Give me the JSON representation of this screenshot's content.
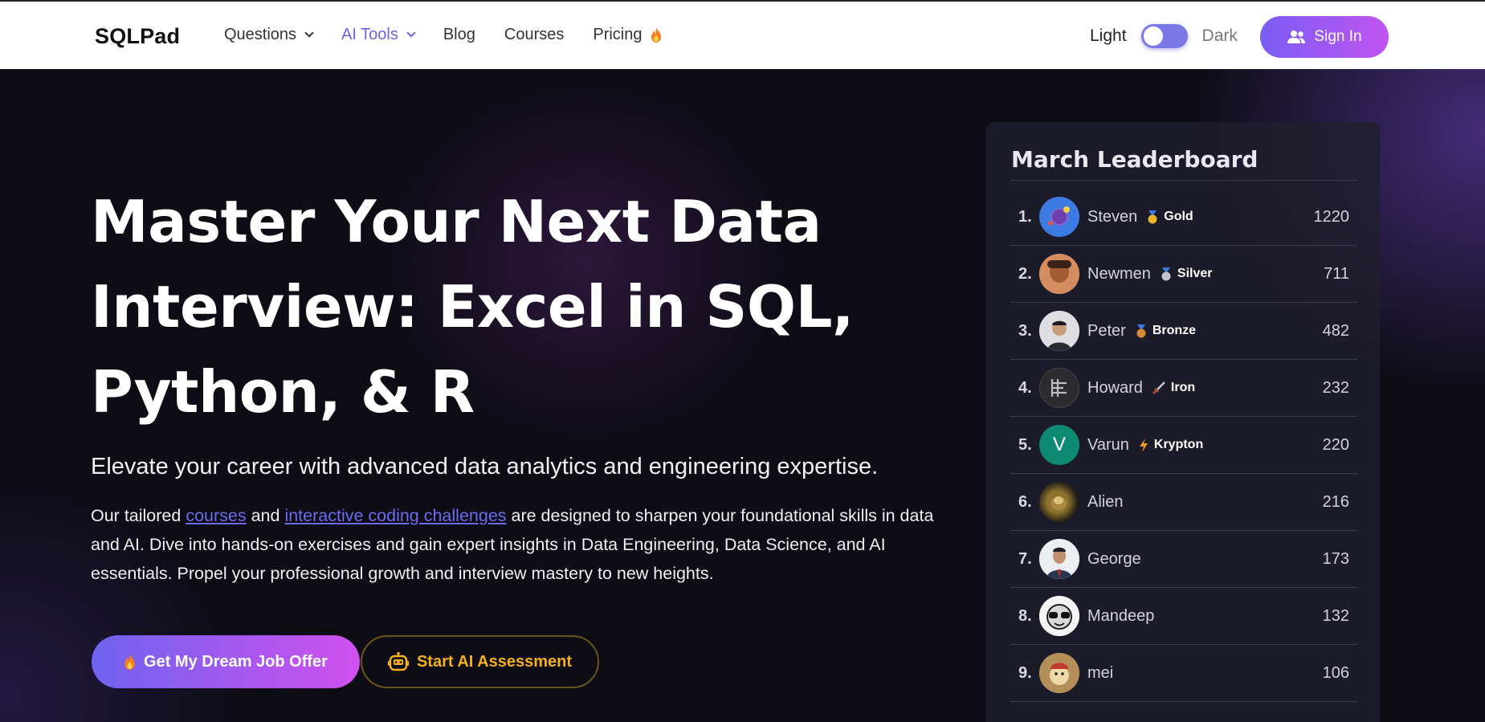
{
  "nav": {
    "logo": "SQLPad",
    "links": [
      {
        "label": "Questions",
        "dropdown": true,
        "active": false
      },
      {
        "label": "AI Tools",
        "dropdown": true,
        "active": true
      },
      {
        "label": "Blog",
        "dropdown": false,
        "active": false
      },
      {
        "label": "Courses",
        "dropdown": false,
        "active": false
      },
      {
        "label": "Pricing",
        "dropdown": false,
        "active": false,
        "icon": "flame-icon"
      }
    ],
    "theme_light": "Light",
    "theme_dark": "Dark",
    "signin_label": "Sign In",
    "accent": "#6a63e6"
  },
  "hero": {
    "headline": "Master Your Next Data Interview: Excel in SQL, Python, & R",
    "subhead": "Elevate your career with advanced data analytics and engineering expertise.",
    "para_1": "Our tailored ",
    "link_courses": "courses",
    "para_2": " and ",
    "link_challenges": "interactive coding challenges",
    "para_3": " are designed to sharpen your foundational skills in data and AI. Dive into hands-on exercises and gain expert insights in Data Engineering, Data Science, and AI essentials. Propel your professional growth and interview mastery to new heights.",
    "cta_primary": "Get My Dream Job Offer",
    "cta_secondary": "Start AI Assessment"
  },
  "leaderboard": {
    "title": "March Leaderboard",
    "entries": [
      {
        "rank": "1.",
        "name": "Steven",
        "badge": "Gold",
        "badge_icon": "gold-medal-icon",
        "score": "1220"
      },
      {
        "rank": "2.",
        "name": "Newmen",
        "badge": "Silver",
        "badge_icon": "silver-medal-icon",
        "score": "711"
      },
      {
        "rank": "3.",
        "name": "Peter",
        "badge": "Bronze",
        "badge_icon": "bronze-medal-icon",
        "score": "482"
      },
      {
        "rank": "4.",
        "name": "Howard",
        "badge": "Iron",
        "badge_icon": "iron-sword-icon",
        "score": "232"
      },
      {
        "rank": "5.",
        "name": "Varun",
        "badge": "Krypton",
        "badge_icon": "lightning-icon",
        "score": "220",
        "avatar_letter": "V"
      },
      {
        "rank": "6.",
        "name": "Alien",
        "badge": "",
        "score": "216"
      },
      {
        "rank": "7.",
        "name": "George",
        "badge": "",
        "score": "173"
      },
      {
        "rank": "8.",
        "name": "Mandeep",
        "badge": "",
        "score": "132"
      },
      {
        "rank": "9.",
        "name": "mei",
        "badge": "",
        "score": "106"
      }
    ]
  }
}
